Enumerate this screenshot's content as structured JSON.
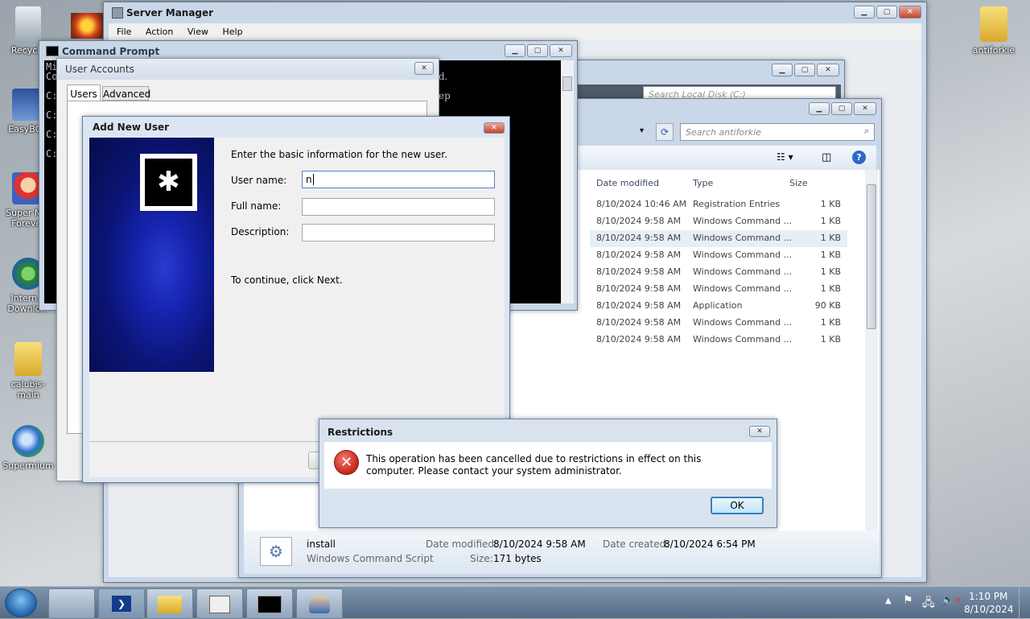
{
  "desktop": {
    "icons_left": [
      {
        "label": "Recycle",
        "name": "recycle-bin-icon"
      },
      {
        "label": "EasyBCD",
        "name": "easybcd-icon"
      },
      {
        "label": "Super M... Forever",
        "name": "super-mario-forever-icon"
      },
      {
        "label": "Intern... Downlo...",
        "name": "internet-download-manager-icon"
      },
      {
        "label": "calubjs-main",
        "name": "calubjs-main-folder-icon"
      },
      {
        "label": "Supermium",
        "name": "supermium-icon"
      }
    ],
    "icon_right": {
      "label": "antiforkie",
      "name": "antiforkie-folder-icon"
    }
  },
  "server_manager": {
    "title": "Server Manager",
    "menu": [
      "File",
      "Action",
      "View",
      "Help"
    ]
  },
  "command_prompt": {
    "title": "Command Prompt",
    "lines": [
      "Mi",
      "Co",
      "",
      "C:",
      "",
      "C:",
      "C:",
      "C:"
    ],
    "right_fragments": [
      "d.",
      "ep"
    ]
  },
  "explorer_back": {
    "search_placeholder": "Search Local Disk (C:)"
  },
  "explorer_front": {
    "search_placeholder": "Search antiforkie",
    "columns": [
      "Date modified",
      "Type",
      "Size"
    ],
    "rows": [
      {
        "date": "8/10/2024 10:46 AM",
        "type": "Registration Entries",
        "size": "1 KB"
      },
      {
        "date": "8/10/2024 9:58 AM",
        "type": "Windows Command ...",
        "size": "1 KB"
      },
      {
        "date": "8/10/2024 9:58 AM",
        "type": "Windows Command ...",
        "size": "1 KB"
      },
      {
        "date": "8/10/2024 9:58 AM",
        "type": "Windows Command ...",
        "size": "1 KB"
      },
      {
        "date": "8/10/2024 9:58 AM",
        "type": "Windows Command ...",
        "size": "1 KB"
      },
      {
        "date": "8/10/2024 9:58 AM",
        "type": "Windows Command ...",
        "size": "1 KB"
      },
      {
        "date": "8/10/2024 9:58 AM",
        "type": "Application",
        "size": "90 KB"
      },
      {
        "date": "8/10/2024 9:58 AM",
        "type": "Windows Command ...",
        "size": "1 KB"
      },
      {
        "date": "8/10/2024 9:58 AM",
        "type": "Windows Command ...",
        "size": "1 KB"
      }
    ],
    "details": {
      "name": "install",
      "kind": "Windows Command Script",
      "modified_label": "Date modified:",
      "modified_value": "8/10/2024 9:58 AM",
      "created_label": "Date created:",
      "created_value": "8/10/2024 6:54 PM",
      "size_label": "Size:",
      "size_value": "171 bytes"
    }
  },
  "user_accounts": {
    "title": "User Accounts",
    "tabs": [
      "Users",
      "Advanced"
    ]
  },
  "add_user": {
    "title": "Add New User",
    "intro": "Enter the basic information for the new user.",
    "username_label": "User name:",
    "username_value": "n",
    "fullname_label": "Full name:",
    "description_label": "Description:",
    "continue_text": "To continue, click Next."
  },
  "restrictions": {
    "title": "Restrictions",
    "message": "This operation has been cancelled due to restrictions in effect on this computer. Please contact your system administrator.",
    "ok": "OK"
  },
  "taskbar": {
    "time": "1:10 PM",
    "date": "8/10/2024",
    "buttons": [
      "server-manager-task",
      "powershell-task",
      "explorer-task",
      "snapshot-task",
      "cmd-task",
      "users-task"
    ]
  }
}
